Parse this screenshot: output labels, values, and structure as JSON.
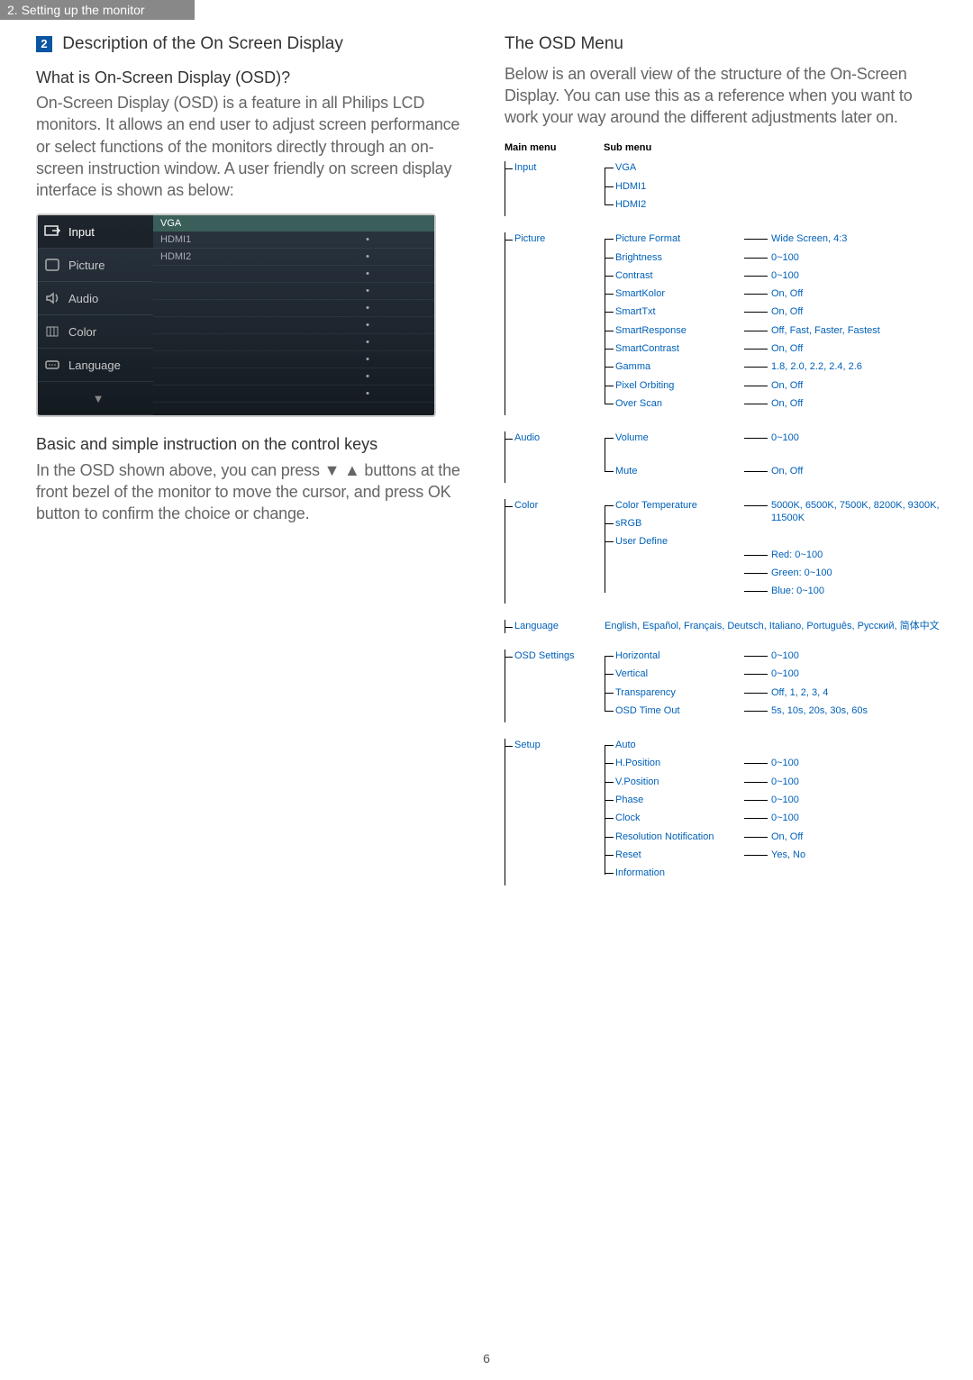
{
  "header_bar": "2. Setting up the monitor",
  "page_number": "6",
  "left": {
    "sec_num": "2",
    "sec_title": "Description of the On Screen Display",
    "q_title": "What is On-Screen Display (OSD)?",
    "q_para": "On-Screen Display (OSD) is a feature in all Philips LCD monitors. It allows an end user to adjust screen performance or select functions of the monitors directly through an on-screen instruction window. A user friendly on screen display interface is shown as below:",
    "osd_tabs": [
      "Input",
      "Picture",
      "Audio",
      "Color",
      "Language"
    ],
    "osd_header": "VGA",
    "osd_rows": [
      "HDMI1",
      "HDMI2"
    ],
    "keys_title": "Basic and simple instruction on the control keys",
    "keys_para": "In the OSD shown above, you can press ▼ ▲ buttons at the front bezel of the monitor to move the cursor, and press OK button to confirm the choice or change."
  },
  "right": {
    "title": "The OSD Menu",
    "intro": "Below is an overall view of the structure of the On-Screen Display. You can use this as a reference when you want to work your way around the different adjustments later on.",
    "head_main": "Main menu",
    "head_sub": "Sub menu",
    "groups": [
      {
        "main": "Input",
        "subs": [
          "VGA",
          "HDMI1",
          "HDMI2"
        ],
        "vals": [
          "",
          "",
          ""
        ]
      },
      {
        "main": "Picture",
        "subs": [
          "Picture Format",
          "Brightness",
          "Contrast",
          "SmartKolor",
          "SmartTxt",
          "SmartResponse",
          "SmartContrast",
          "Gamma",
          "Pixel Orbiting",
          "Over Scan"
        ],
        "vals": [
          "Wide Screen, 4:3",
          "0~100",
          "0~100",
          "On, Off",
          "On, Off",
          "Off, Fast, Faster, Fastest",
          "On, Off",
          "1.8, 2.0, 2.2, 2.4, 2.6",
          "On, Off",
          "On, Off"
        ]
      },
      {
        "main": "Audio",
        "subs": [
          "Volume",
          "Mute"
        ],
        "vals": [
          "0~100",
          "On, Off"
        ],
        "gap_after_first": true
      },
      {
        "main": "Color",
        "subs": [
          "Color Temperature",
          "sRGB",
          "User Define"
        ],
        "vals": [
          "5000K, 6500K, 7500K, 8200K, 9300K, 11500K",
          "",
          "Red: 0~100\nGreen: 0~100\nBlue: 0~100"
        ]
      },
      {
        "main": "Language",
        "subs": [
          "English, Español, Français, Deutsch, Italiano, Português, Русский, 简体中文"
        ],
        "vals": [
          ""
        ],
        "inline_text": true
      },
      {
        "main": "OSD Settings",
        "subs": [
          "Horizontal",
          "Vertical",
          "Transparency",
          "OSD Time Out"
        ],
        "vals": [
          "0~100",
          "0~100",
          "Off, 1, 2, 3, 4",
          "5s, 10s, 20s, 30s, 60s"
        ]
      },
      {
        "main": "Setup",
        "subs": [
          "Auto",
          "H.Position",
          "V.Position",
          "Phase",
          "Clock",
          "Resolution Notification",
          "Reset",
          "Information"
        ],
        "vals": [
          "",
          "0~100",
          "0~100",
          "0~100",
          "0~100",
          "On, Off",
          "Yes, No",
          ""
        ]
      }
    ]
  }
}
